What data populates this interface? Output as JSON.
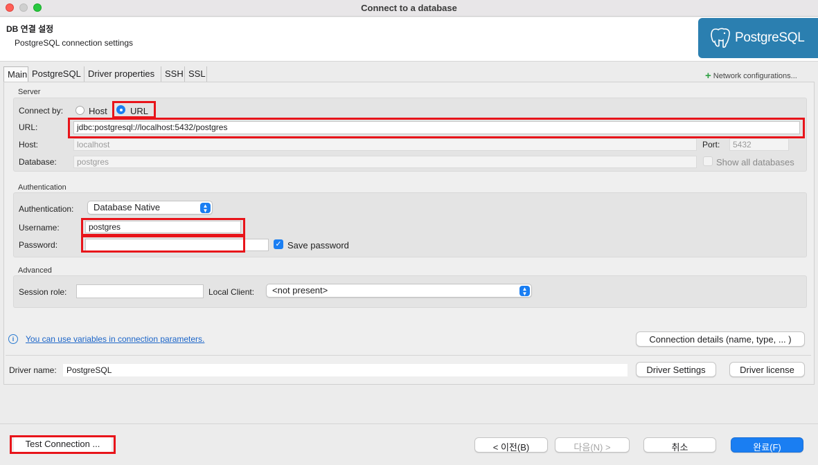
{
  "window": {
    "title": "Connect to a database"
  },
  "header": {
    "title": "DB 연결 설정",
    "subtitle": "PostgreSQL connection settings",
    "logo_text": "PostgreSQL"
  },
  "tabs": [
    {
      "label": "Main",
      "active": true
    },
    {
      "label": "PostgreSQL",
      "active": false
    },
    {
      "label": "Driver properties",
      "active": false
    },
    {
      "label": "SSH",
      "active": false
    },
    {
      "label": "SSL",
      "active": false
    }
  ],
  "network_config": {
    "label": "Network configurations..."
  },
  "server": {
    "group_label": "Server",
    "connect_by_label": "Connect by:",
    "host_option": "Host",
    "url_option": "URL",
    "selected": "URL",
    "url_label": "URL:",
    "url_value": "jdbc:postgresql://localhost:5432/postgres",
    "host_label": "Host:",
    "host_value": "localhost",
    "port_label": "Port:",
    "port_value": "5432",
    "database_label": "Database:",
    "database_value": "postgres",
    "show_all_label": "Show all databases",
    "show_all_checked": false
  },
  "auth": {
    "group_label": "Authentication",
    "auth_label": "Authentication:",
    "auth_value": "Database Native",
    "username_label": "Username:",
    "username_value": "postgres",
    "password_label": "Password:",
    "password_value": "",
    "save_password_label": "Save password",
    "save_password_checked": true
  },
  "advanced": {
    "group_label": "Advanced",
    "session_role_label": "Session role:",
    "session_role_value": "",
    "local_client_label": "Local Client:",
    "local_client_value": "<not present>"
  },
  "info": {
    "icon": "info-icon",
    "link_text": "You can use variables in connection parameters."
  },
  "buttons": {
    "connection_details": "Connection details (name, type, ... )",
    "driver_settings": "Driver Settings",
    "driver_license": "Driver license",
    "test_connection": "Test Connection ...",
    "back": "< 이전(B)",
    "next": "다음(N) >",
    "cancel": "취소",
    "finish": "완료(F)"
  },
  "driver": {
    "label": "Driver name:",
    "value": "PostgreSQL"
  },
  "colors": {
    "accent": "#1a7ef2",
    "highlight": "#e8141a",
    "logo_bg": "#2b7fb0"
  }
}
